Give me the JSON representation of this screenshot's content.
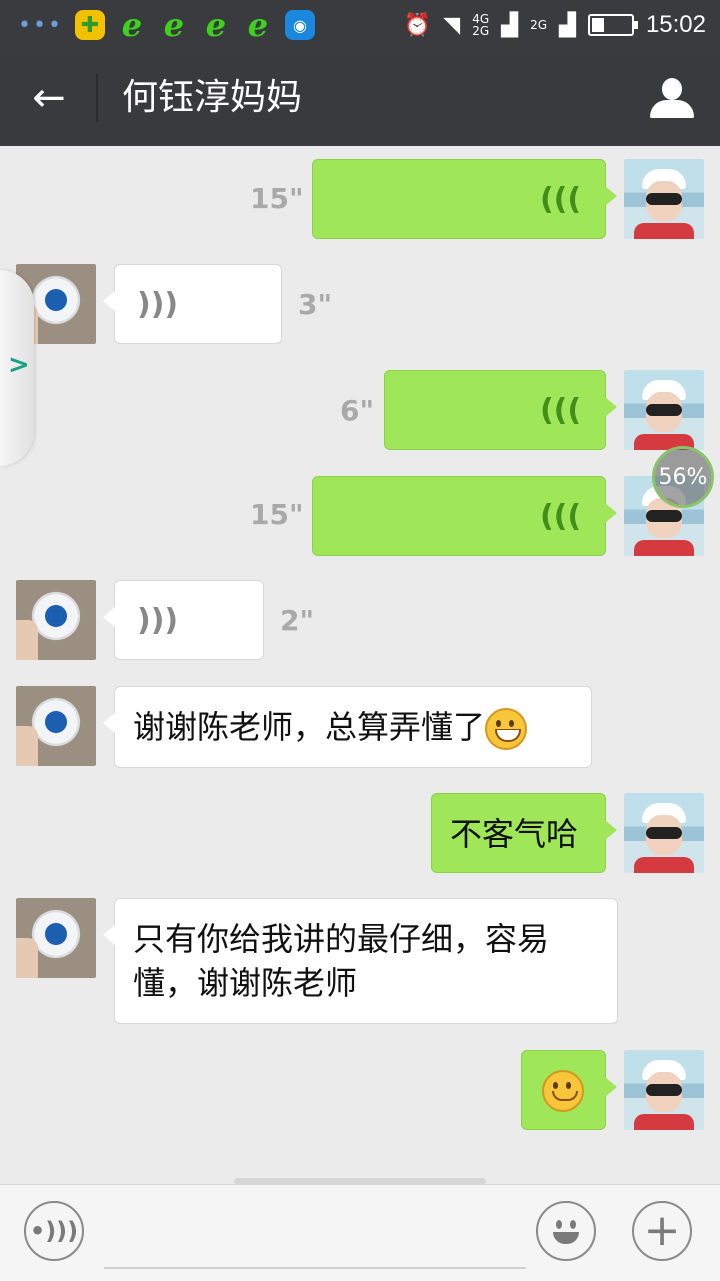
{
  "status_bar": {
    "notifications": [
      "dots-icon",
      "plus-app-icon",
      "ie-icon",
      "ie-icon",
      "ie-icon",
      "ie-icon",
      "wifi-key-icon"
    ],
    "network_labels": [
      "4G",
      "2G"
    ],
    "network_labels_2": "2G",
    "time": "15:02",
    "battery_level": 0.28
  },
  "header": {
    "back_icon": "arrow-left-icon",
    "title": "何钰淳妈妈",
    "profile_icon": "person-icon"
  },
  "messages": [
    {
      "sender": "self",
      "type": "voice",
      "duration": "15\""
    },
    {
      "sender": "other",
      "type": "voice",
      "duration": "3\""
    },
    {
      "sender": "self",
      "type": "voice",
      "duration": "6\""
    },
    {
      "sender": "self",
      "type": "voice",
      "duration": "15\""
    },
    {
      "sender": "other",
      "type": "voice",
      "duration": "2\""
    },
    {
      "sender": "other",
      "type": "text",
      "text": "谢谢陈老师，总算弄懂了",
      "emoji": "grin-emoji"
    },
    {
      "sender": "self",
      "type": "text",
      "text": "不客气哈"
    },
    {
      "sender": "other",
      "type": "text",
      "text_line1": "只有你给我讲的最仔细，容易",
      "text_line2": "懂，谢谢陈老师"
    },
    {
      "sender": "self",
      "type": "emoji",
      "emoji": "smile-emoji"
    }
  ],
  "overlay": {
    "progress_label": "56%",
    "progress": 0.56,
    "side_tab_arrow": ">"
  },
  "input_bar": {
    "voice_toggle_icon": "voice-icon",
    "text_value": "",
    "emoji_icon": "smiley-icon",
    "plus_icon": "plus-icon",
    "plus_symbol": "+"
  },
  "colors": {
    "self_bubble": "#9fe658",
    "other_bubble": "#ffffff",
    "header": "#393a3e",
    "background": "#ebebeb"
  }
}
